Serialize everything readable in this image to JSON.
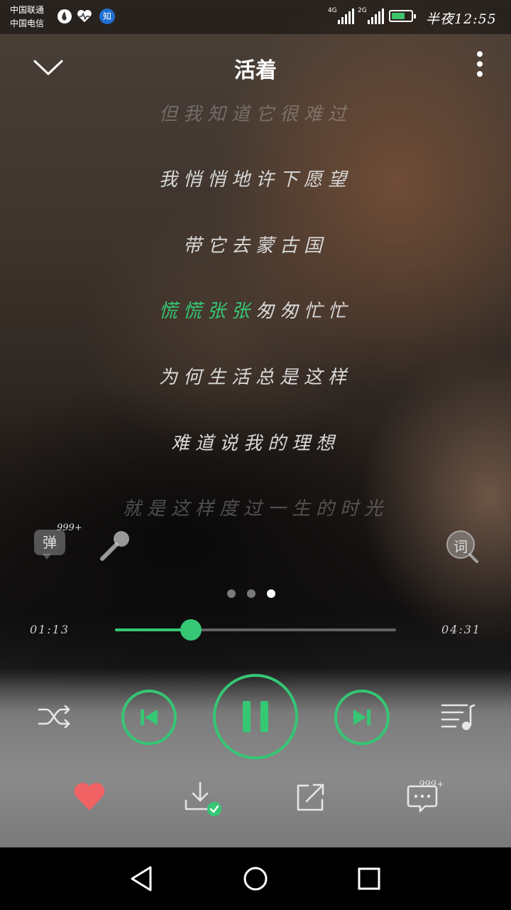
{
  "status": {
    "carrier1": "中国联通",
    "carrier2": "中国电信",
    "zhihu_label": "知",
    "net1": "4G",
    "net2": "2G",
    "time": "半夜12:55"
  },
  "header": {
    "title": "活着"
  },
  "lyrics": {
    "lines": [
      {
        "text": "但我知道它很难过",
        "state": "faded"
      },
      {
        "text": "我悄悄地许下愿望",
        "state": "normal"
      },
      {
        "text": "带它去蒙古国",
        "state": "normal"
      },
      {
        "text_played": "慌慌张张",
        "text_rest": "匆匆忙忙",
        "state": "current"
      },
      {
        "text": "为何生活总是这样",
        "state": "normal"
      },
      {
        "text": "难道说我的理想",
        "state": "normal"
      },
      {
        "text": "就是这样度过一生的时光",
        "state": "faded"
      }
    ]
  },
  "tools": {
    "danmu_label": "弹",
    "danmu_count": "999+",
    "lyrics_button_label": "词"
  },
  "pager": {
    "count": 3,
    "active": 2
  },
  "progress": {
    "current": "01:13",
    "total": "04:31",
    "fraction": 0.27
  },
  "actions": {
    "comment_count": "999+",
    "favorited": true
  },
  "colors": {
    "accent": "#35c774",
    "heart": "#f06263"
  }
}
